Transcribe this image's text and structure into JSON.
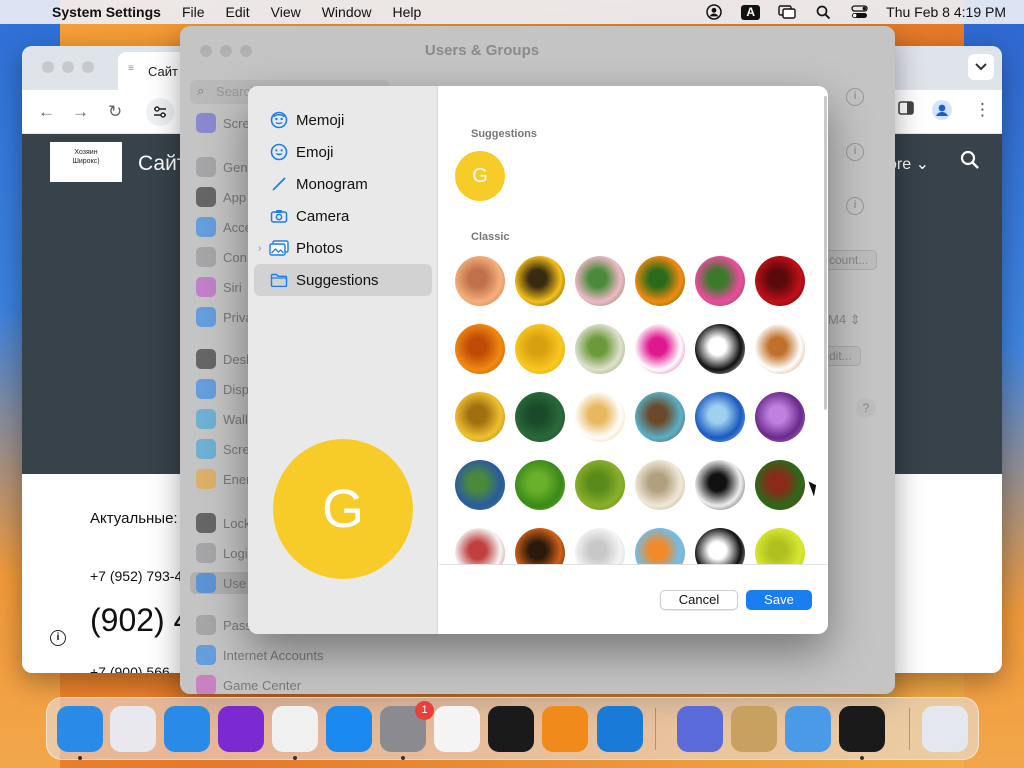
{
  "menubar": {
    "app": "System Settings",
    "items": [
      "File",
      "Edit",
      "View",
      "Window",
      "Help"
    ],
    "clock": "Thu Feb 8  4:19 PM",
    "icons": [
      "user-icon",
      "input-source-icon",
      "screen-mirror-icon",
      "spotlight-icon",
      "control-center-icon"
    ]
  },
  "chrome": {
    "tab_title": "Сайт з",
    "logo_text": "Хозяин\nШирокс)",
    "site_title": "Сайт",
    "more_label": "ore",
    "text_current": "Актуальные:",
    "phone1": "+7 (952) 793-4",
    "phone_big": "(902) 4",
    "phone2": "+7 (900) 566-"
  },
  "settings": {
    "title": "Users & Groups",
    "search_placeholder": "Search",
    "sidebar": [
      {
        "label": "Scre",
        "color": "#5a5ad8"
      },
      {
        "label": "Gen",
        "color": "#8e8e93"
      },
      {
        "label": "App",
        "color": "#1a1a1a"
      },
      {
        "label": "Acce",
        "color": "#1a7df0"
      },
      {
        "label": "Con",
        "color": "#8e8e93"
      },
      {
        "label": "Siri",
        "color": "#c04ad0"
      },
      {
        "label": "Priva",
        "color": "#1a7df0"
      },
      {
        "label": "Desk",
        "color": "#1a1a1a"
      },
      {
        "label": "Disp",
        "color": "#1a7df0"
      },
      {
        "label": "Wall",
        "color": "#2aa0e0"
      },
      {
        "label": "Scre",
        "color": "#2aa0e0"
      },
      {
        "label": "Ener",
        "color": "#f0a020"
      },
      {
        "label": "Lock",
        "color": "#1a1a1a"
      },
      {
        "label": "Logi",
        "color": "#8e8e93"
      },
      {
        "label": "Use",
        "color": "#1a7df0"
      },
      {
        "label": "Pass",
        "color": "#8e8e93"
      },
      {
        "label": "Internet Accounts",
        "color": "#1a7df0"
      },
      {
        "label": "Game Center",
        "color": "#d04ac0"
      }
    ],
    "account_btn": "count...",
    "arch_label": "M4",
    "edit_btn": "dit..."
  },
  "dialog": {
    "sources": [
      {
        "label": "Memoji",
        "icon": "memoji-icon"
      },
      {
        "label": "Emoji",
        "icon": "emoji-icon"
      },
      {
        "label": "Monogram",
        "icon": "monogram-icon"
      },
      {
        "label": "Camera",
        "icon": "camera-icon"
      },
      {
        "label": "Photos",
        "icon": "photos-icon"
      },
      {
        "label": "Suggestions",
        "icon": "folder-icon"
      }
    ],
    "preview_letter": "G",
    "section_suggestions": "Suggestions",
    "suggestion_letter": "G",
    "section_classic": "Classic",
    "avatars": [
      {
        "name": "rose-avatar",
        "colors": [
          "#f4b07a",
          "#c0704a"
        ]
      },
      {
        "name": "sunflower-avatar",
        "colors": [
          "#f4c01a",
          "#3a2a10"
        ]
      },
      {
        "name": "lotus-avatar",
        "colors": [
          "#f0b8c8",
          "#4a8a3a"
        ]
      },
      {
        "name": "poppy-avatar",
        "colors": [
          "#f48a10",
          "#2a6a1a"
        ]
      },
      {
        "name": "zinnia-avatar",
        "colors": [
          "#f04aa0",
          "#3a7a2a"
        ]
      },
      {
        "name": "red-rose-avatar",
        "colors": [
          "#c01018",
          "#5a0a0a"
        ]
      },
      {
        "name": "orange-daisy-avatar",
        "colors": [
          "#f08a10",
          "#c04a08"
        ]
      },
      {
        "name": "yellow-daisy-avatar",
        "colors": [
          "#f8c820",
          "#d8a010"
        ]
      },
      {
        "name": "dandelion-avatar",
        "colors": [
          "#e0e0d0",
          "#6a9a3a"
        ]
      },
      {
        "name": "lips-avatar",
        "colors": [
          "#ffffff",
          "#e01890"
        ]
      },
      {
        "name": "yin-yang-avatar",
        "colors": [
          "#111111",
          "#ffffff"
        ]
      },
      {
        "name": "gingerbread-avatar",
        "colors": [
          "#ffffff",
          "#c0702a"
        ]
      },
      {
        "name": "medal-avatar",
        "colors": [
          "#f0c030",
          "#a07010"
        ]
      },
      {
        "name": "chalkboard-avatar",
        "colors": [
          "#2a6a3a",
          "#1a4a2a"
        ]
      },
      {
        "name": "fortune-cookie-avatar",
        "colors": [
          "#ffffff",
          "#e8b860"
        ]
      },
      {
        "name": "eggs-nest-avatar",
        "colors": [
          "#5ab0c8",
          "#6a4a2a"
        ]
      },
      {
        "name": "snowflake-avatar",
        "colors": [
          "#1a5ac0",
          "#a0d0f0"
        ]
      },
      {
        "name": "lightning-avatar",
        "colors": [
          "#6a2a8a",
          "#c080e0"
        ]
      },
      {
        "name": "earth-avatar",
        "colors": [
          "#2a5aa0",
          "#4a8a3a"
        ]
      },
      {
        "name": "leaf-avatar",
        "colors": [
          "#3a8a1a",
          "#6ab02a"
        ]
      },
      {
        "name": "drop-leaf-avatar",
        "colors": [
          "#8ab02a",
          "#5a8a1a"
        ]
      },
      {
        "name": "sand-dollar-avatar",
        "colors": [
          "#f0e8d8",
          "#b0a080"
        ]
      },
      {
        "name": "zebra-avatar",
        "colors": [
          "#eeeeee",
          "#111111"
        ]
      },
      {
        "name": "football-avatar",
        "colors": [
          "#2a6a1a",
          "#8a2a1a"
        ]
      },
      {
        "name": "baseball-avatar",
        "colors": [
          "#f4f4f4",
          "#c04040"
        ]
      },
      {
        "name": "basketball-avatar",
        "colors": [
          "#d0601a",
          "#2a1a0a"
        ]
      },
      {
        "name": "golf-ball-avatar",
        "colors": [
          "#f4f4f4",
          "#c8c8c8"
        ]
      },
      {
        "name": "surf-avatar",
        "colors": [
          "#6ac0f0",
          "#f08a2a"
        ]
      },
      {
        "name": "8-ball-avatar",
        "colors": [
          "#111111",
          "#ffffff"
        ]
      },
      {
        "name": "tennis-ball-avatar",
        "colors": [
          "#d8e830",
          "#b0c020"
        ]
      }
    ],
    "cancel": "Cancel",
    "save": "Save"
  },
  "dock": {
    "apps": [
      {
        "name": "finder-icon",
        "color": "#2a8ae8"
      },
      {
        "name": "launchpad-icon",
        "color": "#e8e8ee"
      },
      {
        "name": "safari-icon",
        "color": "#2a8ae8"
      },
      {
        "name": "firefox-icon",
        "color": "#7a2ad0"
      },
      {
        "name": "chrome-icon",
        "color": "#f0f0f0"
      },
      {
        "name": "app-store-icon",
        "color": "#1a8af0"
      },
      {
        "name": "system-settings-icon",
        "color": "#8a8a90"
      },
      {
        "name": "textedit-icon",
        "color": "#f4f4f4"
      },
      {
        "name": "terminal-icon",
        "color": "#1a1a1a"
      },
      {
        "name": "garageband-icon",
        "color": "#f08a1a"
      },
      {
        "name": "vscode-icon",
        "color": "#1a7ad8"
      },
      {
        "name": "screen-sharing-icon",
        "color": "#5a6ad8"
      },
      {
        "name": "contacts-icon",
        "color": "#c8a060"
      },
      {
        "name": "finder-migration-icon",
        "color": "#4a9ae8"
      },
      {
        "name": "tuxedo-icon",
        "color": "#1a1a1a"
      },
      {
        "name": "trash-icon",
        "color": "#e4e8ee"
      }
    ],
    "badge": "1"
  }
}
